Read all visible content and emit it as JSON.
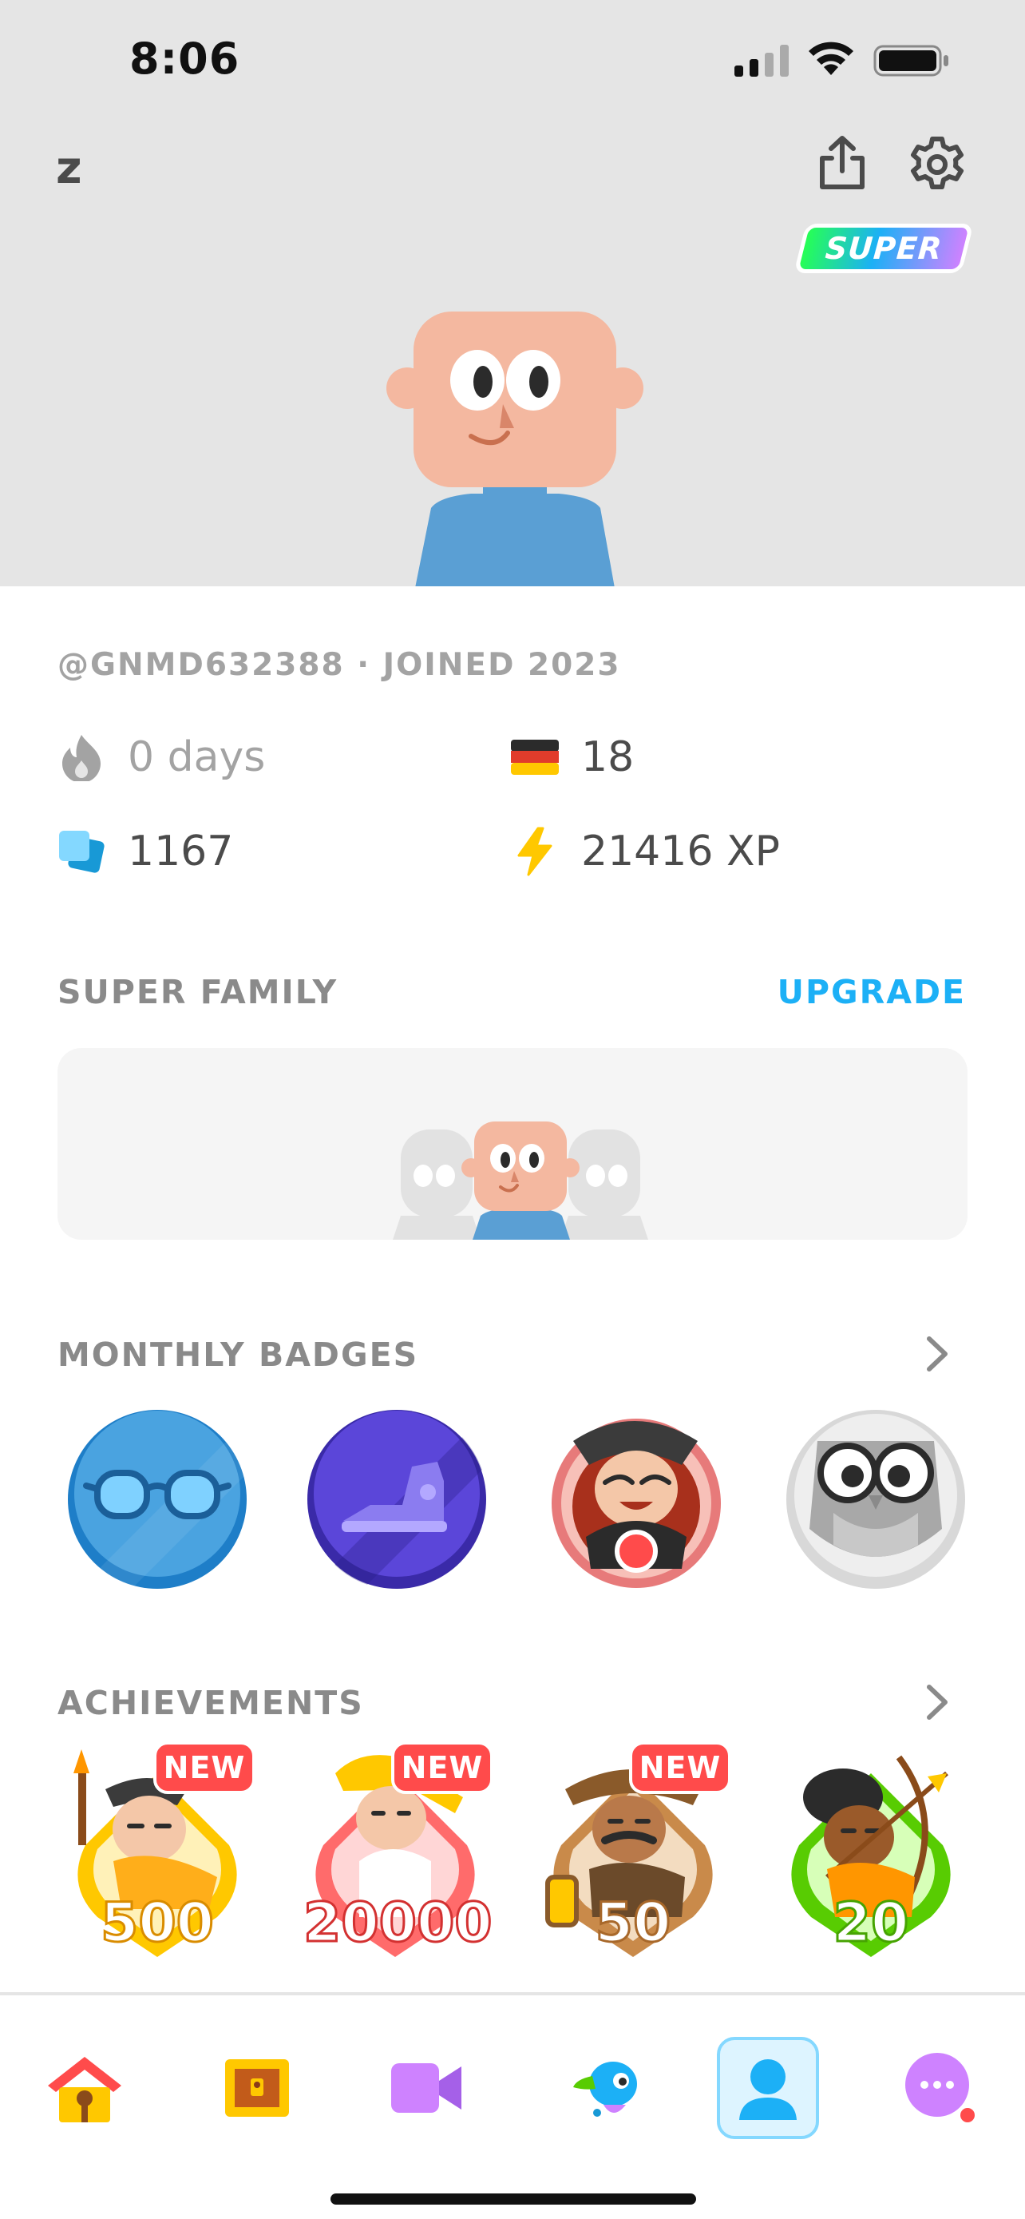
{
  "status_bar": {
    "time": "8:06"
  },
  "header": {
    "username": "z",
    "super_label": "SUPER"
  },
  "profile": {
    "handle_joined": "@GNMD632388 · JOINED 2023"
  },
  "stats": {
    "streak": "0 days",
    "language_count": "18",
    "words": "1167",
    "xp": "21416 XP"
  },
  "super_family": {
    "title": "SUPER FAMILY",
    "upgrade_label": "UPGRADE"
  },
  "monthly_badges": {
    "title": "MONTHLY BADGES",
    "items": [
      "glasses-badge-icon",
      "sneaker-badge-icon",
      "scooter-character-badge-icon",
      "owl-glasses-badge-icon"
    ]
  },
  "achievements": {
    "title": "ACHIEVEMENTS",
    "items": [
      {
        "value": "500",
        "new_label": "NEW",
        "icon": "painter-achievement-icon"
      },
      {
        "value": "20000",
        "new_label": "NEW",
        "icon": "baby-achievement-icon"
      },
      {
        "value": "50",
        "new_label": "NEW",
        "icon": "explorer-achievement-icon"
      },
      {
        "value": "20",
        "new_label": "",
        "icon": "archer-achievement-icon"
      }
    ]
  },
  "bottom_nav": {
    "items": [
      "home-icon",
      "treasure-chest-icon",
      "video-call-icon",
      "duo-bird-icon",
      "profile-icon",
      "more-icon"
    ],
    "active": "profile-icon"
  },
  "colors": {
    "accent_blue": "#1cb0f6",
    "new_red": "#ff4b4b",
    "hero_bg": "#e5e5e5",
    "xp_yellow": "#ffc800"
  }
}
